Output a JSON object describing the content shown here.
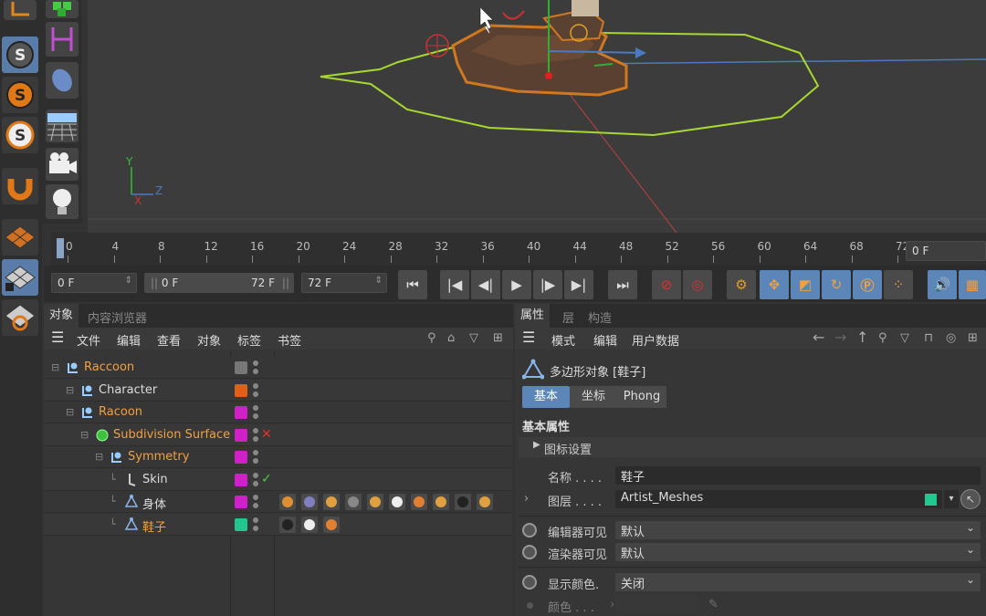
{
  "viewport": {
    "axis_labels": {
      "y": "Y",
      "z": "Z",
      "x": "X"
    }
  },
  "timeline": {
    "ticks": [
      "0",
      "4",
      "8",
      "12",
      "16",
      "20",
      "24",
      "28",
      "32",
      "36",
      "40",
      "44",
      "48",
      "52",
      "56",
      "60",
      "64",
      "68",
      "72"
    ],
    "current_frame": "0 F"
  },
  "transport": {
    "start_field": "0 F",
    "range_start": "0 F",
    "range_end": "72 F",
    "end_field": "72 F"
  },
  "object_manager": {
    "tabs": [
      "对象",
      "内容浏览器"
    ],
    "menu": [
      "文件",
      "编辑",
      "查看",
      "对象",
      "标签",
      "书签"
    ],
    "objects": [
      {
        "name": "Raccoon",
        "color": "#f0a040",
        "swatch": "#777777",
        "indent": 0
      },
      {
        "name": "Character",
        "color": "#dddddd",
        "swatch": "#e06018",
        "indent": 1
      },
      {
        "name": "Racoon",
        "color": "#f0a040",
        "swatch": "#d020c8",
        "indent": 1
      },
      {
        "name": "Subdivision Surface",
        "color": "#f0a040",
        "swatch": "#d020c8",
        "indent": 2
      },
      {
        "name": "Symmetry",
        "color": "#f0a040",
        "swatch": "#d020c8",
        "indent": 3
      },
      {
        "name": "Skin",
        "color": "#dddddd",
        "swatch": "#d020c8",
        "indent": 4
      },
      {
        "name": "身体",
        "color": "#dddddd",
        "swatch": "#d020c8",
        "indent": 4
      },
      {
        "name": "鞋子",
        "color": "#f0a040",
        "swatch": "#20c890",
        "indent": 4
      }
    ]
  },
  "attributes": {
    "tabs": [
      "属性",
      "层",
      "构造"
    ],
    "menu": [
      "模式",
      "编辑",
      "用户数据"
    ],
    "object_title": "多边形对象 [鞋子]",
    "subtabs": [
      "基本",
      "坐标",
      "Phong"
    ],
    "section": "基本属性",
    "collapsible": "图标设置",
    "fields": {
      "name_label": "名称 . . . .",
      "name_value": "鞋子",
      "layer_label": "图层 . . . .",
      "layer_value": "Artist_Meshes",
      "editor_visible_label": "编辑器可见",
      "editor_visible_value": "默认",
      "render_visible_label": "渲染器可见",
      "render_visible_value": "默认",
      "display_color_label": "显示颜色.",
      "display_color_value": "关闭",
      "color_label": "颜色 . . ."
    },
    "layer_color": "#20c890"
  }
}
